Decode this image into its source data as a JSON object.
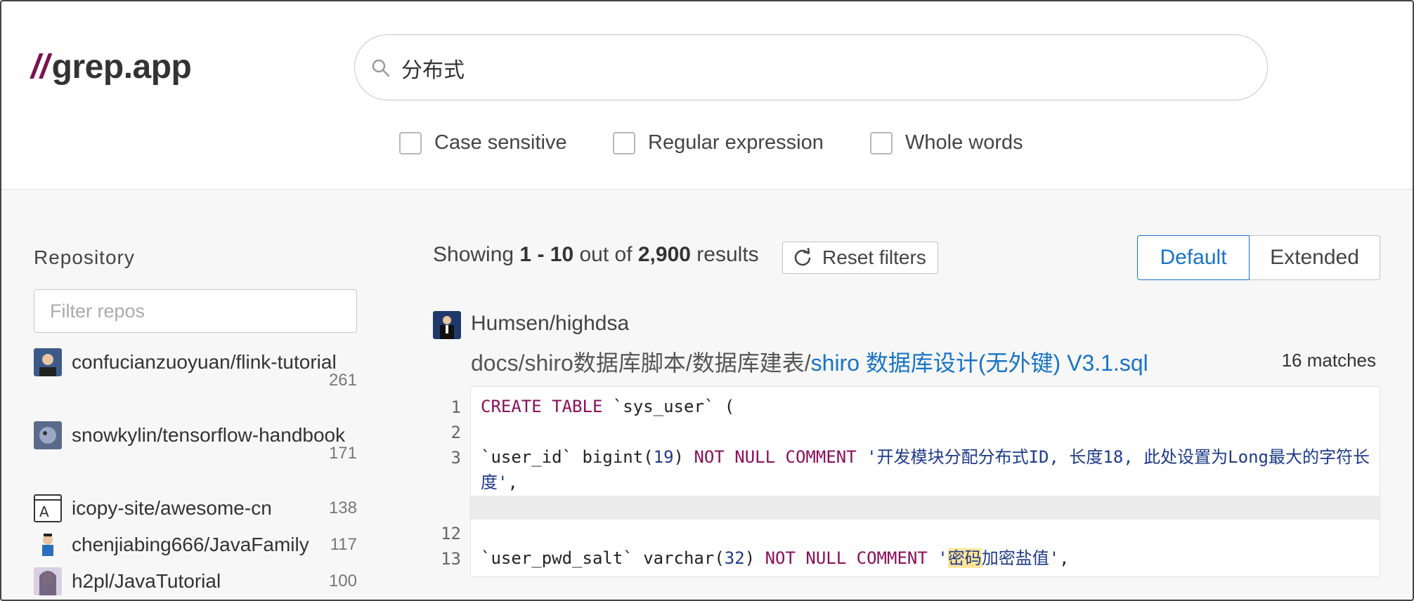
{
  "header": {
    "logo_slashes": "//",
    "logo_text": "grep.app",
    "search_value": "分布式",
    "options": [
      {
        "label": "Case sensitive",
        "checked": false
      },
      {
        "label": "Regular expression",
        "checked": false
      },
      {
        "label": "Whole words",
        "checked": false
      }
    ]
  },
  "sidebar": {
    "title": "Repository",
    "filter_placeholder": "Filter repos",
    "repos": [
      {
        "name": "confucianzuoyuan/flink-tutorial",
        "count": "261"
      },
      {
        "name": "snowkylin/tensorflow-handbook",
        "count": "171"
      },
      {
        "name": "icopy-site/awesome-cn",
        "count": "138"
      },
      {
        "name": "chenjiabing666/JavaFamily",
        "count": "117"
      },
      {
        "name": "h2pl/JavaTutorial",
        "count": "100"
      }
    ]
  },
  "results": {
    "showing_prefix": "Showing ",
    "range": "1 - 10",
    "out_of": " out of ",
    "total": "2,900",
    "suffix": " results",
    "reset_label": "Reset filters",
    "view_default": "Default",
    "view_extended": "Extended",
    "item": {
      "repo": "Humsen/highdsa",
      "path_prefix": "docs/shiro数据库脚本/数据库建表/",
      "file_name": "shiro 数据库设计(无外键) V3.1.sql",
      "matches": "16 matches",
      "lines": [
        {
          "no": "1",
          "text": "CREATE TABLE `sys_user` ("
        },
        {
          "no": "2",
          "text": ""
        },
        {
          "no": "3",
          "text": "`user_id` bigint(19) NOT NULL COMMENT '开发模块分配分布式ID, 长度18, 此处设置为Long最大的字符长度',"
        },
        {
          "no": "12",
          "text": ""
        },
        {
          "no": "13",
          "text": "`user_pwd_salt` varchar(32) NOT NULL COMMENT '密码加密盐值',"
        }
      ]
    }
  },
  "colors": {
    "brand": "#7a1450",
    "accent": "#1a73c6",
    "keyword": "#8a0f5a",
    "highlight": "#ffe59a"
  }
}
